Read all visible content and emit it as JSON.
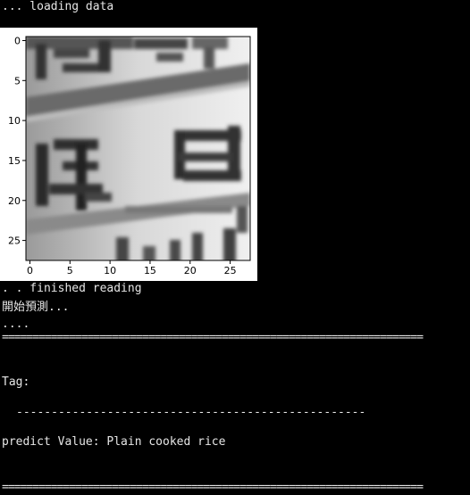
{
  "console": {
    "line_loading": "... loading data",
    "line_finished": ". . finished reading",
    "line_start_predict": "開始預測...",
    "line_dots": "....",
    "rule": "=====================================================================",
    "line_tag": "Tag:",
    "dashes": "--------------------------------------------------",
    "line_predict": "predict Value: Plain cooked rice",
    "rule_bottom": "====================================================================="
  },
  "image_plot": {
    "x_ticks": [
      "0",
      "5",
      "10",
      "15",
      "20",
      "25"
    ],
    "y_ticks": [
      "0",
      "5",
      "10",
      "15",
      "20",
      "25"
    ],
    "x_range": [
      0,
      27
    ],
    "y_range": [
      0,
      27
    ],
    "colormap": "grayscale"
  },
  "colors": {
    "background": "#000000",
    "text": "#e6e6e6"
  }
}
